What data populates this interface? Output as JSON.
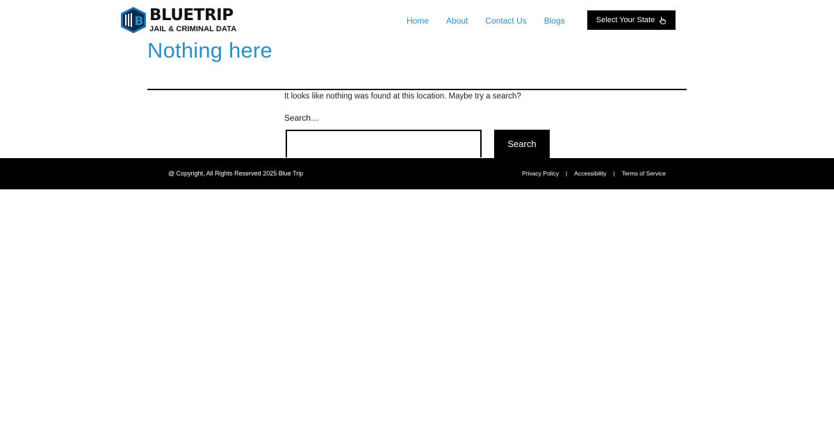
{
  "header": {
    "logo": {
      "name": "BLUETRIP",
      "tagline": "JAIL & CRIMINAL DATA",
      "mark_letter": "B"
    },
    "nav": [
      {
        "label": "Home"
      },
      {
        "label": "About"
      },
      {
        "label": "Contact Us"
      },
      {
        "label": "Blogs"
      }
    ],
    "state_button": {
      "label": "Select Your State",
      "icon": "pointer-hand-icon"
    }
  },
  "main": {
    "title": "Nothing here",
    "notice": "It looks like nothing was found at this location. Maybe try a search?",
    "search": {
      "label": "Search…",
      "value": "",
      "button_label": "Search"
    }
  },
  "footer": {
    "copyright": "@ Copyright, All Rights Reserved 2025 Blue Trip",
    "links": [
      {
        "label": "Privacy Policy"
      },
      {
        "label": "Accessibility"
      },
      {
        "label": "Terms of Service"
      }
    ],
    "separator": "|"
  },
  "colors": {
    "accent": "#2c8fc6",
    "dark": "#000000",
    "logo_blue": "#1f6fb5"
  }
}
